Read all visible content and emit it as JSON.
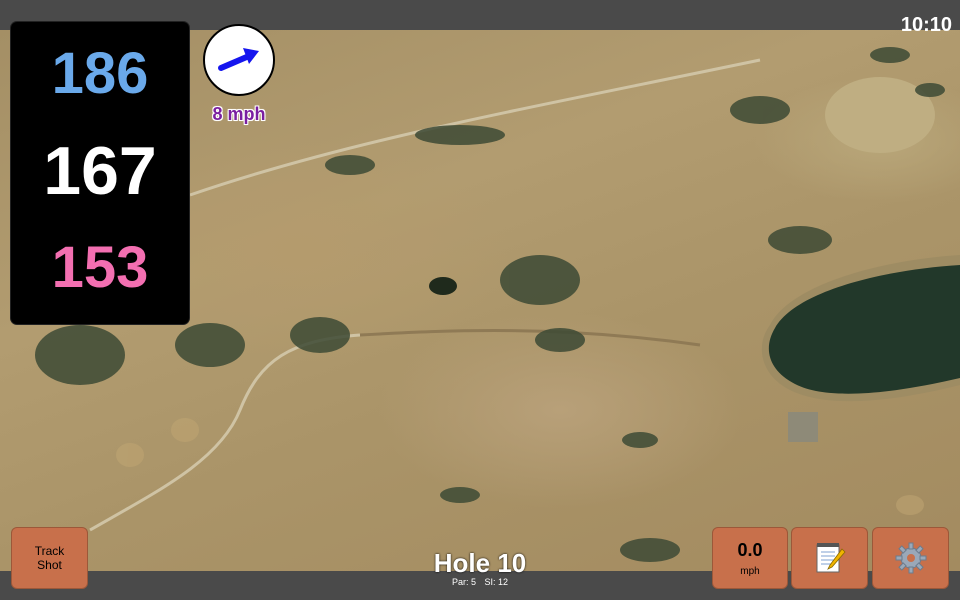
{
  "status_bar": {
    "time": "10:10"
  },
  "distances": {
    "back": "186",
    "middle": "167",
    "front": "153"
  },
  "wind": {
    "speed": "8 mph"
  },
  "hole": {
    "title": "Hole 10",
    "par": "Par: 5",
    "stroke_index": "SI: 12"
  },
  "buttons": {
    "track_shot_line1": "Track",
    "track_shot_line2": "Shot",
    "speed_value": "0.0",
    "speed_unit": "mph"
  },
  "icons": {
    "wind_arrow": "wind-arrow-icon",
    "notes": "notepad-icon",
    "settings": "gear-icon"
  },
  "colors": {
    "back_distance": "#6aa9ea",
    "middle_distance": "#ffffff",
    "front_distance": "#f36fb1",
    "button": "#c8704b"
  }
}
